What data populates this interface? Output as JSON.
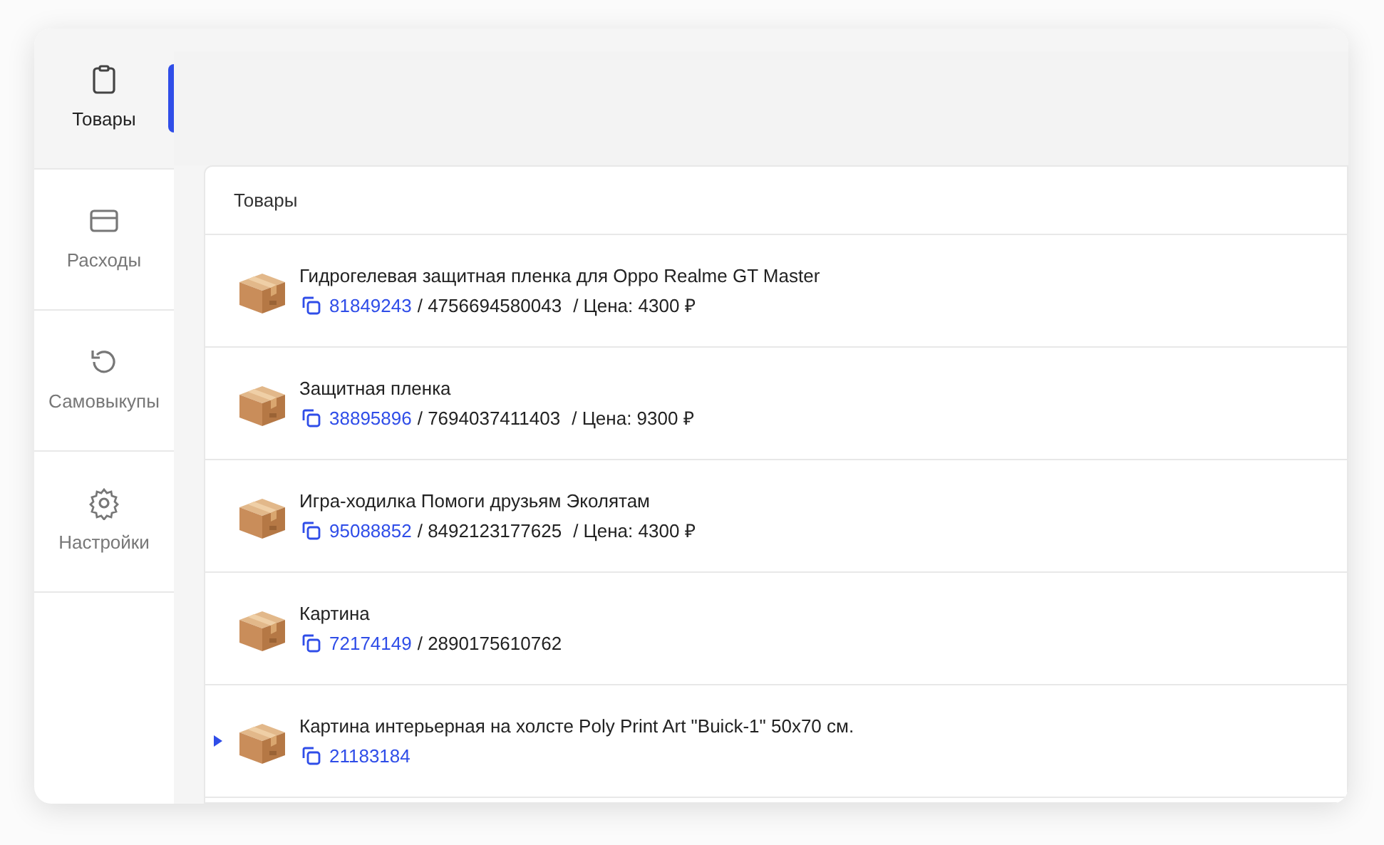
{
  "sidebar": {
    "items": [
      {
        "label": "Товары",
        "selected": true
      },
      {
        "label": "Расходы",
        "selected": false
      },
      {
        "label": "Самовыкупы",
        "selected": false
      },
      {
        "label": "Настройки",
        "selected": false
      }
    ]
  },
  "table": {
    "title": "Товары",
    "rows": [
      {
        "name": "Гидрогелевая защитная пленка для Oppo Realme GT Master",
        "sku": "81849243",
        "barcode": "/ 4756694580043",
        "price": "/ Цена: 4300 ₽",
        "current": false
      },
      {
        "name": "Защитная пленка",
        "sku": "38895896",
        "barcode": "/ 7694037411403",
        "price": "/ Цена: 9300 ₽",
        "current": false
      },
      {
        "name": "Игра-ходилка Помоги друзьям Эколятам",
        "sku": "95088852",
        "barcode": "/ 8492123177625",
        "price": "/ Цена: 4300 ₽",
        "current": false
      },
      {
        "name": "Картина",
        "sku": "72174149",
        "barcode": "/ 2890175610762",
        "current": false
      },
      {
        "name": "Картина интерьерная на холсте Poly Print Art \"Buick-1\" 50x70 см.",
        "sku": "21183184",
        "current": true
      }
    ]
  }
}
